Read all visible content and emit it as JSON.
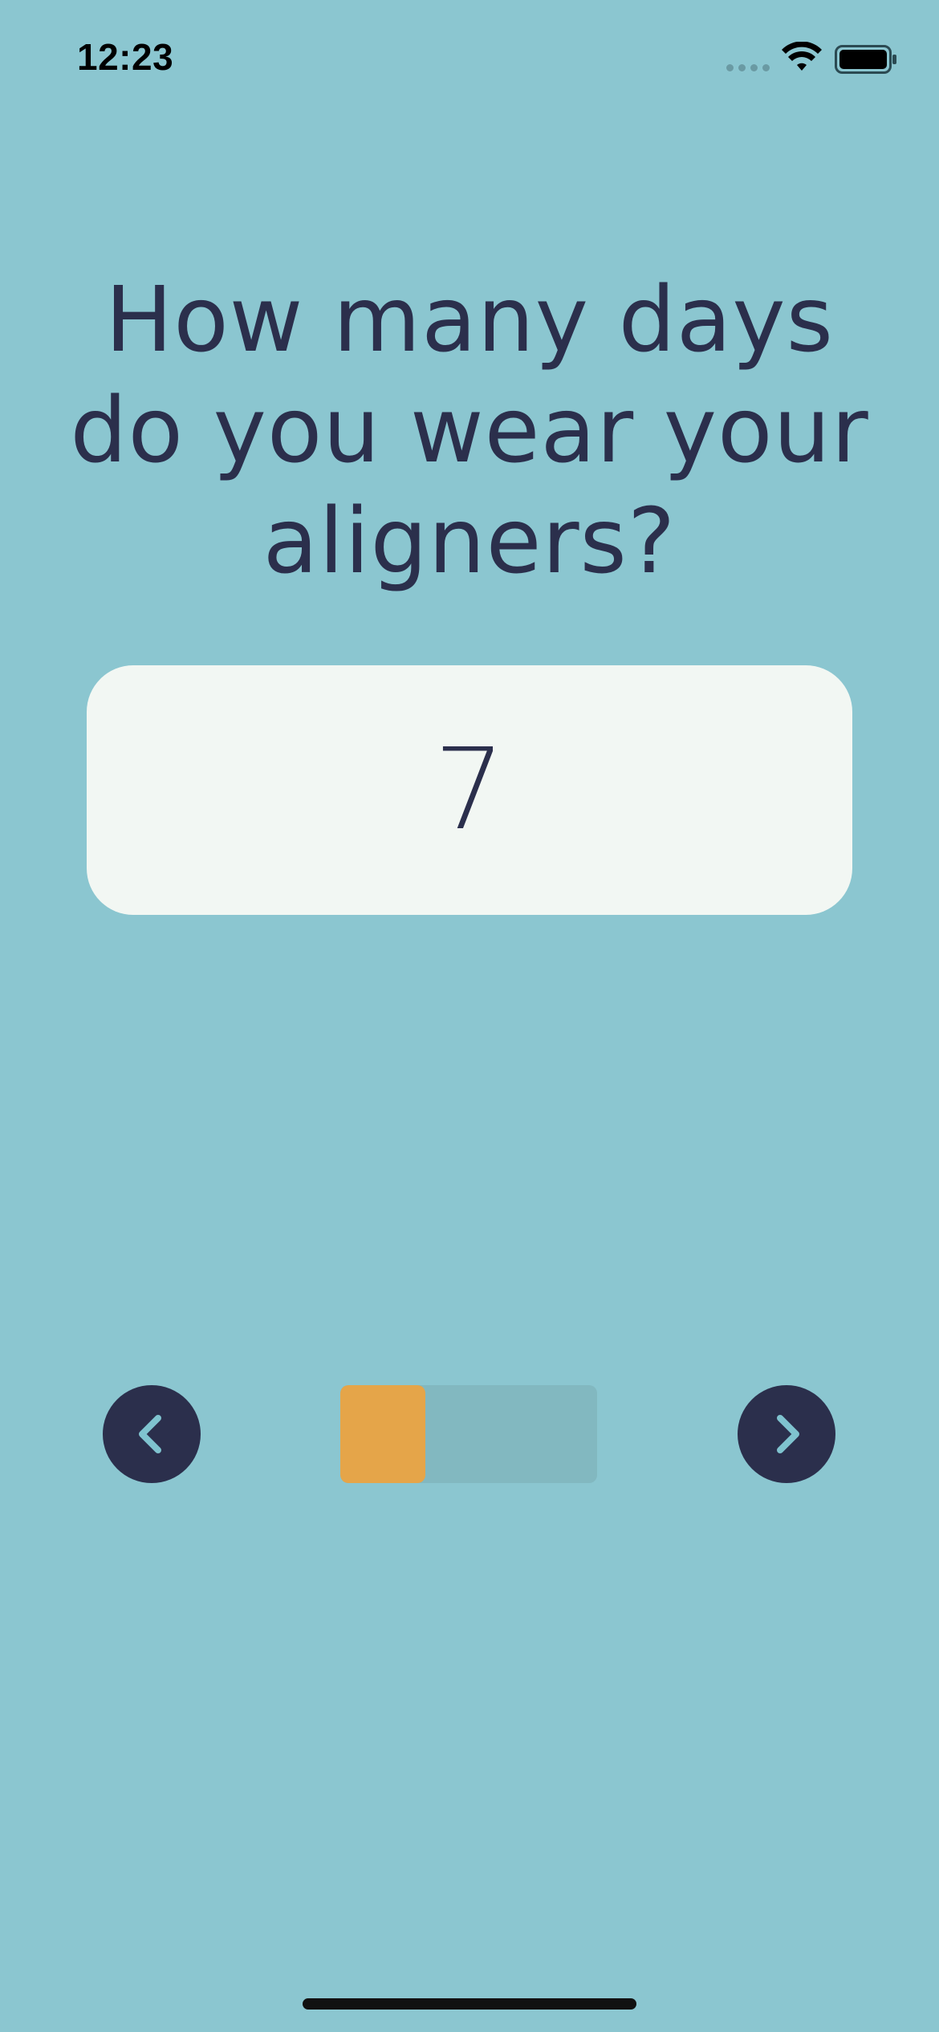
{
  "status_bar": {
    "time": "12:23",
    "icons": [
      "signal-icon",
      "wifi-icon",
      "battery-icon"
    ]
  },
  "question": {
    "title": "How many days do you wear your aligners?"
  },
  "answer": {
    "value": "7"
  },
  "navigation": {
    "prev_icon": "chevron-left-icon",
    "next_icon": "chevron-right-icon",
    "progress_fraction": 0.33
  },
  "colors": {
    "background": "#8BC6D0",
    "text": "#2B2F4C",
    "card": "#F2F7F3",
    "accent": "#E5A549",
    "progress_track": "#82B8C0"
  }
}
